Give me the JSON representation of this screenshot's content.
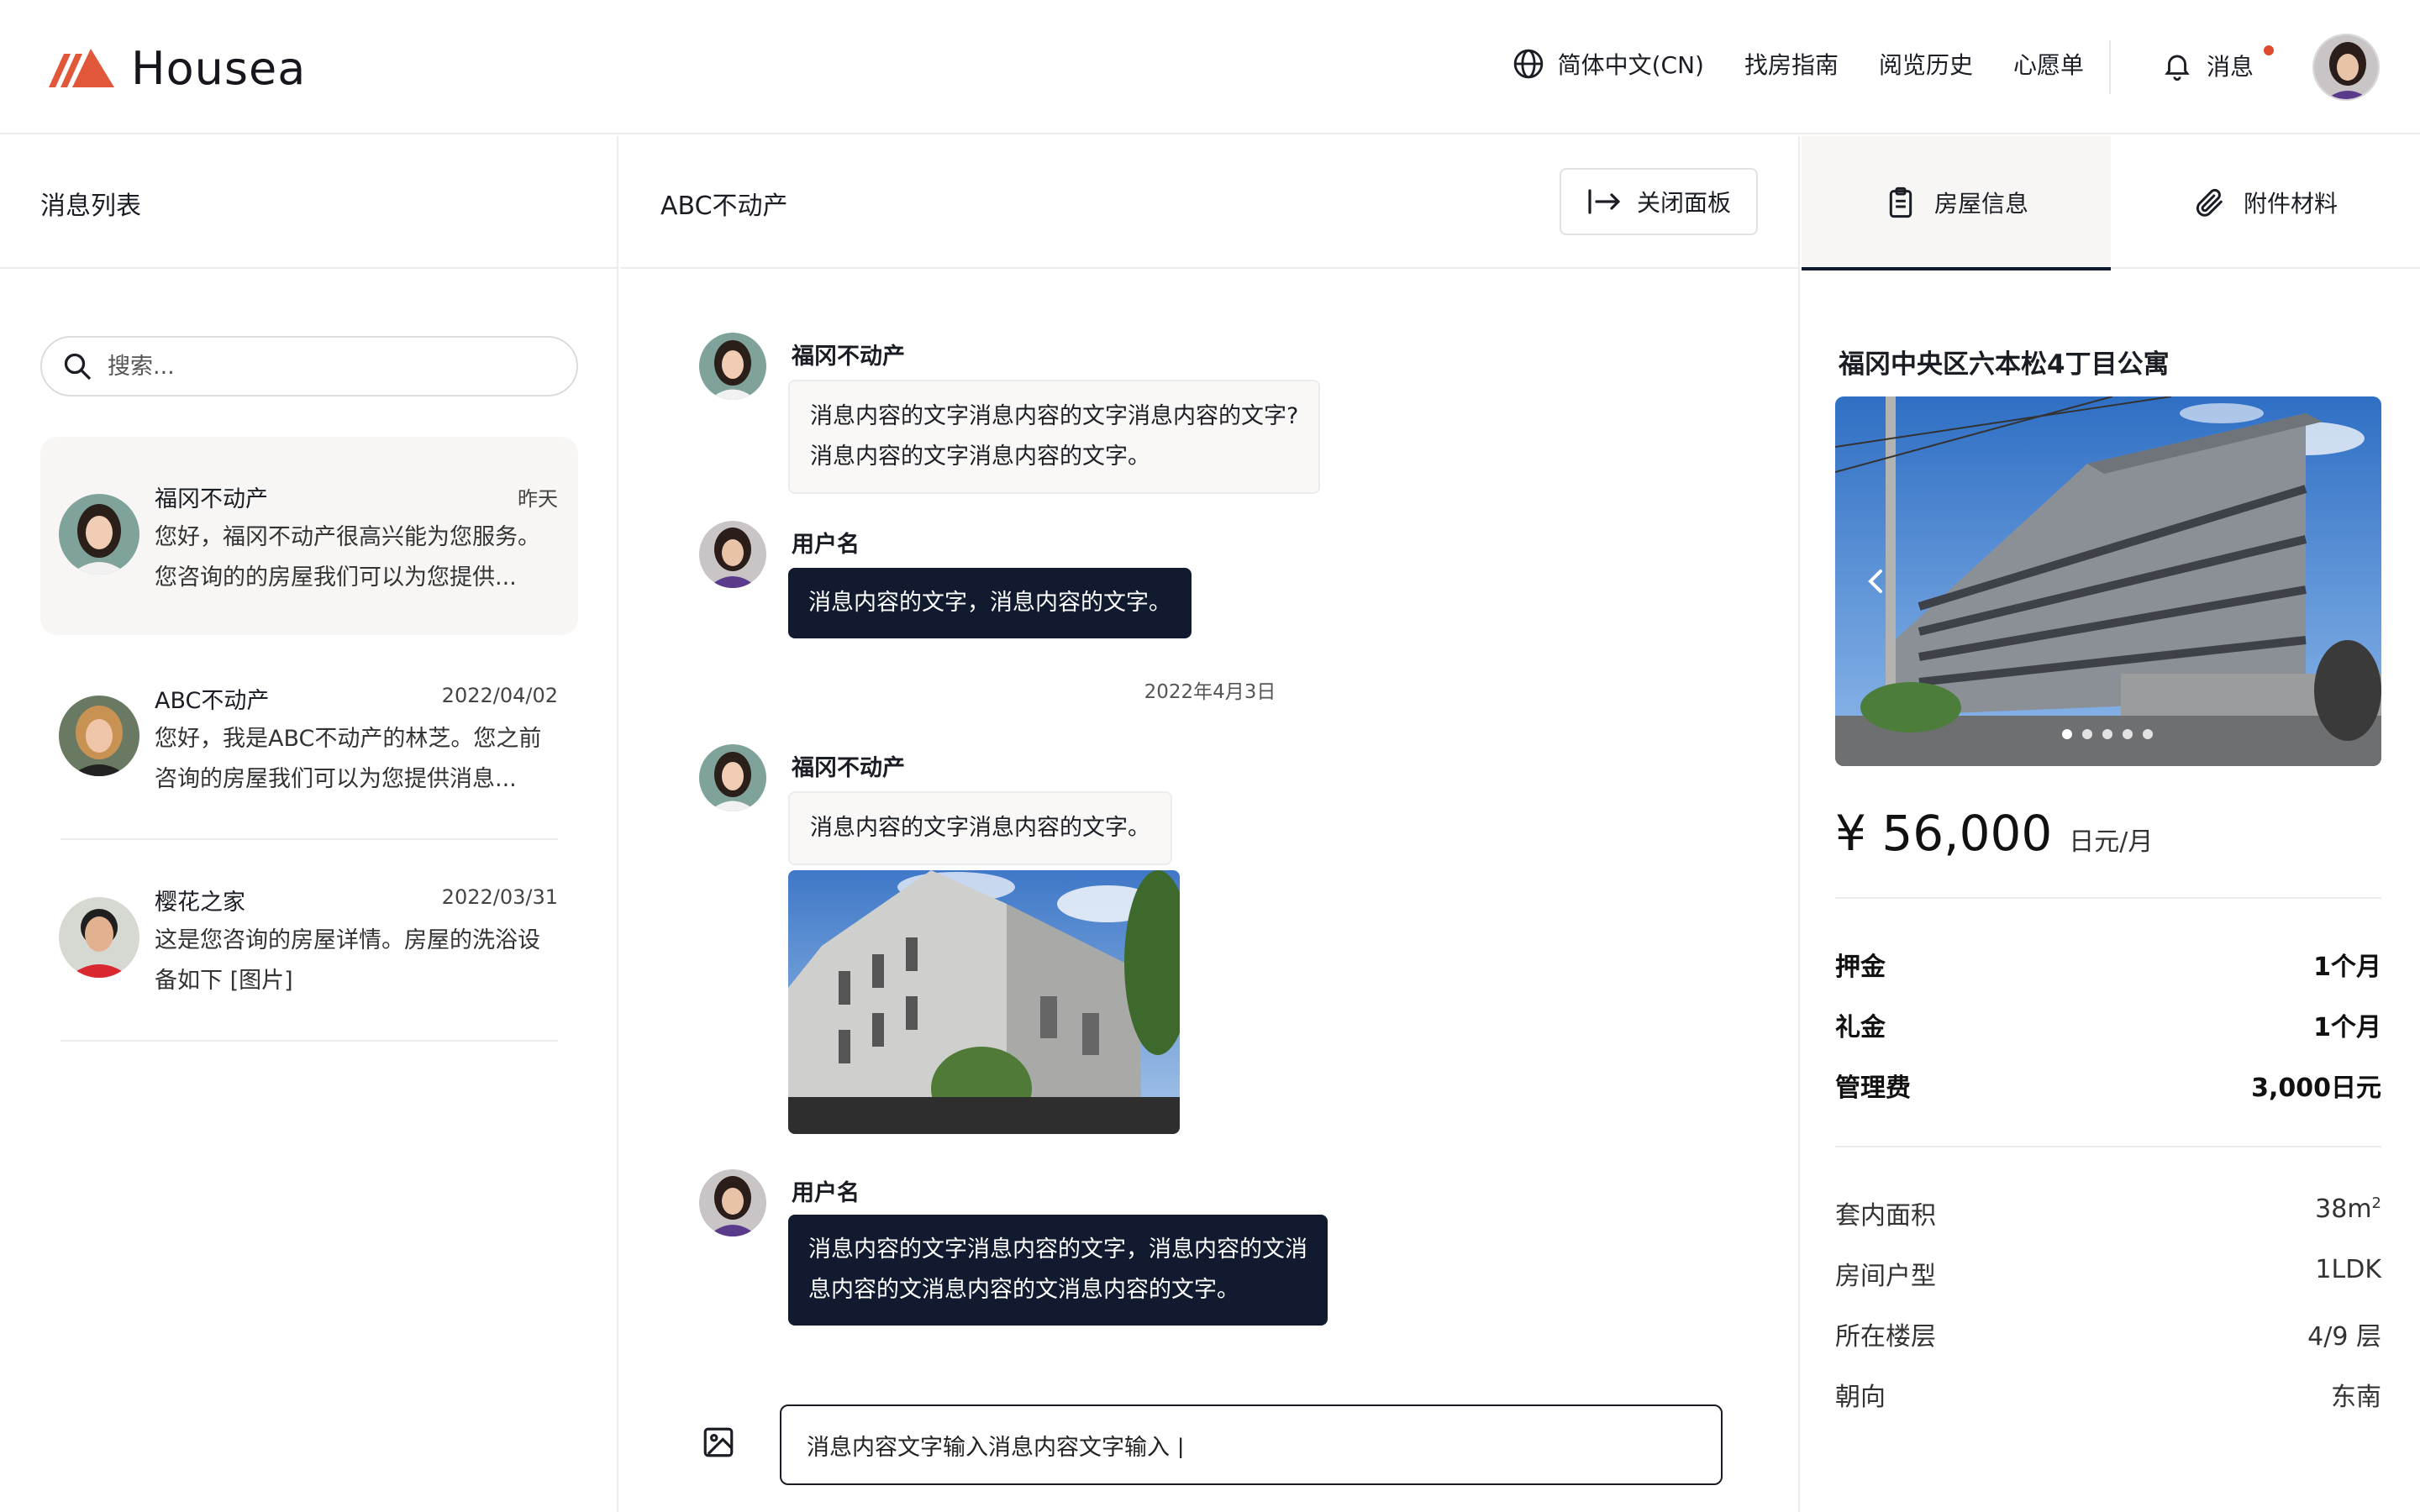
{
  "brand": {
    "name": "Housea"
  },
  "nav": {
    "language": "简体中文(CN)",
    "links": [
      "找房指南",
      "阅览历史",
      "心愿单"
    ],
    "notifications_label": "消息"
  },
  "left": {
    "title": "消息列表",
    "search_placeholder": "搜索...",
    "conversations": [
      {
        "name": "福冈不动产",
        "date": "昨天",
        "preview": "您好，福冈不动产很高兴能为您服务。您咨询的的房屋我们可以为您提供..."
      },
      {
        "name": "ABC不动产",
        "date": "2022/04/02",
        "preview": "您好，我是ABC不动产的林芝。您之前咨询的房屋我们可以为您提供消息..."
      },
      {
        "name": "樱花之家",
        "date": "2022/03/31",
        "preview": "这是您咨询的房屋详情。房屋的洗浴设备如下 [图片]"
      }
    ]
  },
  "chat": {
    "title": "ABC不动产",
    "close_label": "关闭面板",
    "messages": [
      {
        "sender": "福冈不动产",
        "line1": "消息内容的文字消息内容的文字消息内容的文字?",
        "line2": "消息内容的文字消息内容的文字。"
      },
      {
        "sender": "用户名",
        "line1": "消息内容的文字，消息内容的文字。"
      },
      {
        "sender": "福冈不动产",
        "line1": "消息内容的文字消息内容的文字。"
      },
      {
        "sender": "用户名",
        "line1": "消息内容的文字消息内容的文字，消息内容的文消",
        "line2": "息内容的文消息内容的文消息内容的文字。"
      }
    ],
    "date_divider": "2022年4月3日",
    "composer_value": "消息内容文字输入消息内容文字输入 |"
  },
  "panel": {
    "tabs": [
      "房屋信息",
      "附件材料"
    ],
    "property_title": "福冈中央区六本松4丁目公寓",
    "price": "¥ 56,000",
    "price_unit": "日元/月",
    "fees": [
      {
        "label": "押金",
        "value": "1个月"
      },
      {
        "label": "礼金",
        "value": "1个月"
      },
      {
        "label": "管理费",
        "value": "3,000日元"
      }
    ],
    "details": [
      {
        "label": "套内面积",
        "value": "38m",
        "sup": "2"
      },
      {
        "label": "房间户型",
        "value": "1LDK"
      },
      {
        "label": "所在楼层",
        "value": "4/9 层"
      },
      {
        "label": "朝向",
        "value": "东南"
      }
    ],
    "carousel_total": 5,
    "carousel_active": 1
  },
  "colors": {
    "accent": "#e0573a",
    "dark_bubble": "#111a2e",
    "notify_dot": "#e04a2f"
  },
  "icons": [
    "globe-icon",
    "bell-icon",
    "search-icon",
    "close-panel-icon",
    "clipboard-icon",
    "paperclip-icon",
    "image-icon",
    "chevron-left-icon"
  ]
}
